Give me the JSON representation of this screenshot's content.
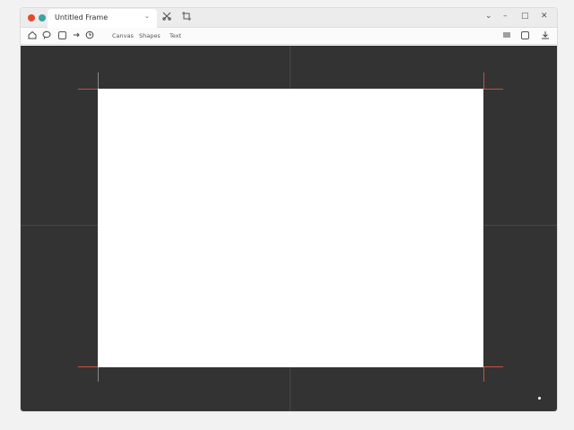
{
  "titlebar": {
    "tab_title": "Untitled Frame",
    "tab_chevron": "⌄",
    "traffic_colors": [
      "#e8482f",
      "#3aa59b"
    ],
    "icons": [
      "scissors-icon",
      "crop-icon"
    ],
    "window_controls": [
      "⌄",
      "–",
      "□",
      "✕"
    ]
  },
  "toolbar": {
    "menu_items": [
      "Canvas",
      "Shapes",
      "Text"
    ],
    "icons": [
      "home-icon",
      "lasso-icon",
      "shape-icon",
      "arrow-icon",
      "rotate-icon",
      "layers-icon",
      "export-icon"
    ]
  },
  "canvas": {
    "background": "#333333",
    "artboard_color": "#ffffff",
    "crop_mark_color": "#c9513e"
  }
}
